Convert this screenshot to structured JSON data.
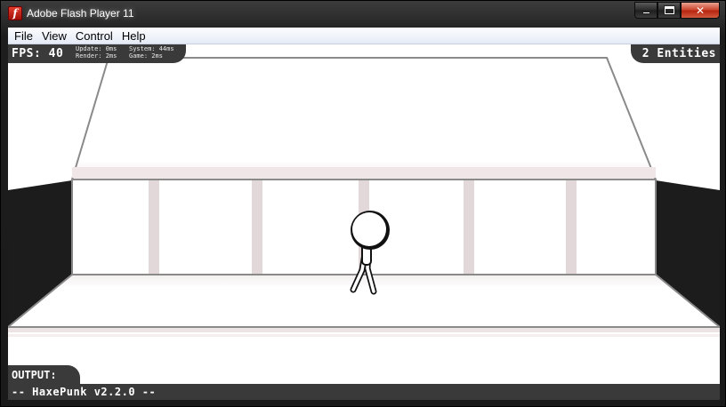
{
  "window": {
    "title": "Adobe Flash Player 11",
    "controls": {
      "minimize_icon": "minimize-icon",
      "maximize_icon": "maximize-icon",
      "close_icon": "close-icon",
      "close_glyph": "✕"
    }
  },
  "menu": {
    "items": [
      {
        "label": "File"
      },
      {
        "label": "View"
      },
      {
        "label": "Control"
      },
      {
        "label": "Help"
      }
    ]
  },
  "hud": {
    "fps": "FPS: 40",
    "update": "Update: 0ms",
    "system": "System: 44ms",
    "render": "Render: 2ms",
    "game": "Game: 2ms",
    "entities": "2 Entities"
  },
  "console": {
    "output_label": "OUTPUT:",
    "output_text": "-- HaxePunk v2.2.0 --"
  },
  "colors": {
    "hud_bg": "#3a3a3a",
    "wall_black": "#1a1a1a",
    "pillar": "#e2d8d9",
    "stage_bg": "#ffffff"
  }
}
